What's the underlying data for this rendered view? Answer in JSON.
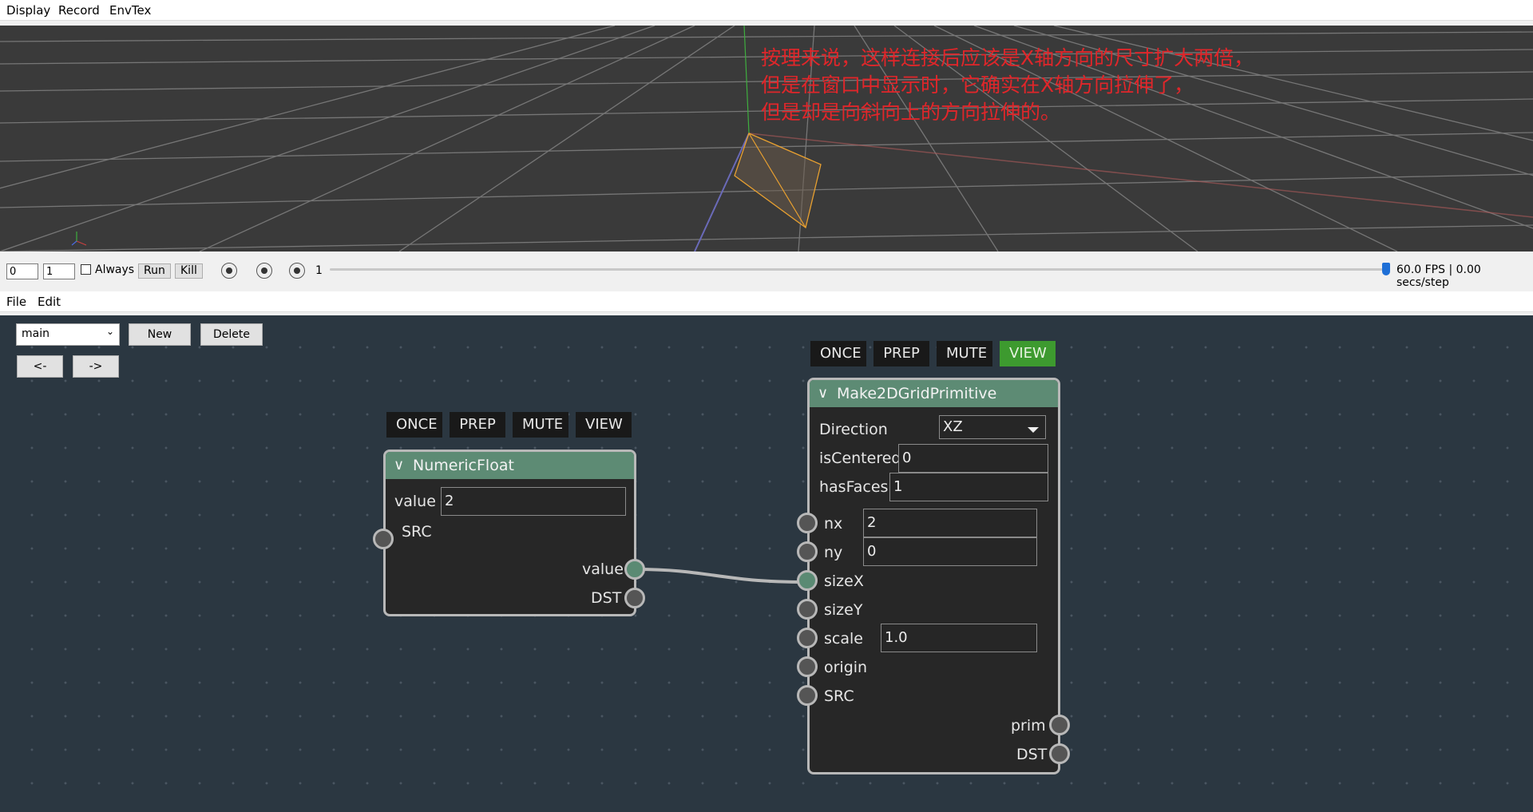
{
  "viewer_menu": {
    "items": [
      "Display",
      "Record",
      "EnvTex"
    ]
  },
  "viewport": {
    "annotation": [
      "按理来说，这样连接后应该是X轴方向的尺寸扩大两倍，",
      "但是在窗口中显示时，它确实在X轴方向拉伸了，",
      "但是却是向斜向上的方向拉伸的。"
    ],
    "colors": {
      "background": "#3a3a3a",
      "annotation": "#e0262a",
      "primitive": "#e8a030"
    }
  },
  "timeline": {
    "start_frame": "0",
    "end_frame": "1",
    "always_label": "Always",
    "run_label": "Run",
    "kill_label": "Kill",
    "current_frame": "1",
    "status": "60.0 FPS | 0.00 secs/step",
    "slider_position": 1.0
  },
  "editor_menu": {
    "items": [
      "File",
      "Edit"
    ]
  },
  "graph_toolbar": {
    "graph_name": "main",
    "new_label": "New",
    "delete_label": "Delete",
    "back_label": "<-",
    "forward_label": "->"
  },
  "nodes": {
    "numeric_float": {
      "title": "NumericFloat",
      "tags": [
        "ONCE",
        "PREP",
        "MUTE",
        "VIEW"
      ],
      "value_label": "value",
      "value": "2",
      "inputs": [
        "SRC"
      ],
      "outputs": [
        "value",
        "DST"
      ]
    },
    "grid": {
      "title": "Make2DGridPrimitive",
      "tags": [
        "ONCE",
        "PREP",
        "MUTE",
        "VIEW"
      ],
      "active_tag": "VIEW",
      "params": {
        "direction_label": "Direction",
        "direction": "XZ",
        "is_centered_label": "isCentered",
        "is_centered": "0",
        "has_faces_label": "hasFaces",
        "has_faces": "1"
      },
      "inputs": {
        "nx": "nx",
        "nx_value": "2",
        "ny": "ny",
        "ny_value": "0",
        "size_x": "sizeX",
        "size_y": "sizeY",
        "scale": "scale",
        "scale_value": "1.0",
        "origin": "origin",
        "src": "SRC"
      },
      "outputs": [
        "prim",
        "DST"
      ]
    }
  },
  "colors": {
    "graph_bg": "#2b3741",
    "node_header": "#5d8b74",
    "view_active": "#3d9a2f",
    "link": "#b8b8b8"
  }
}
